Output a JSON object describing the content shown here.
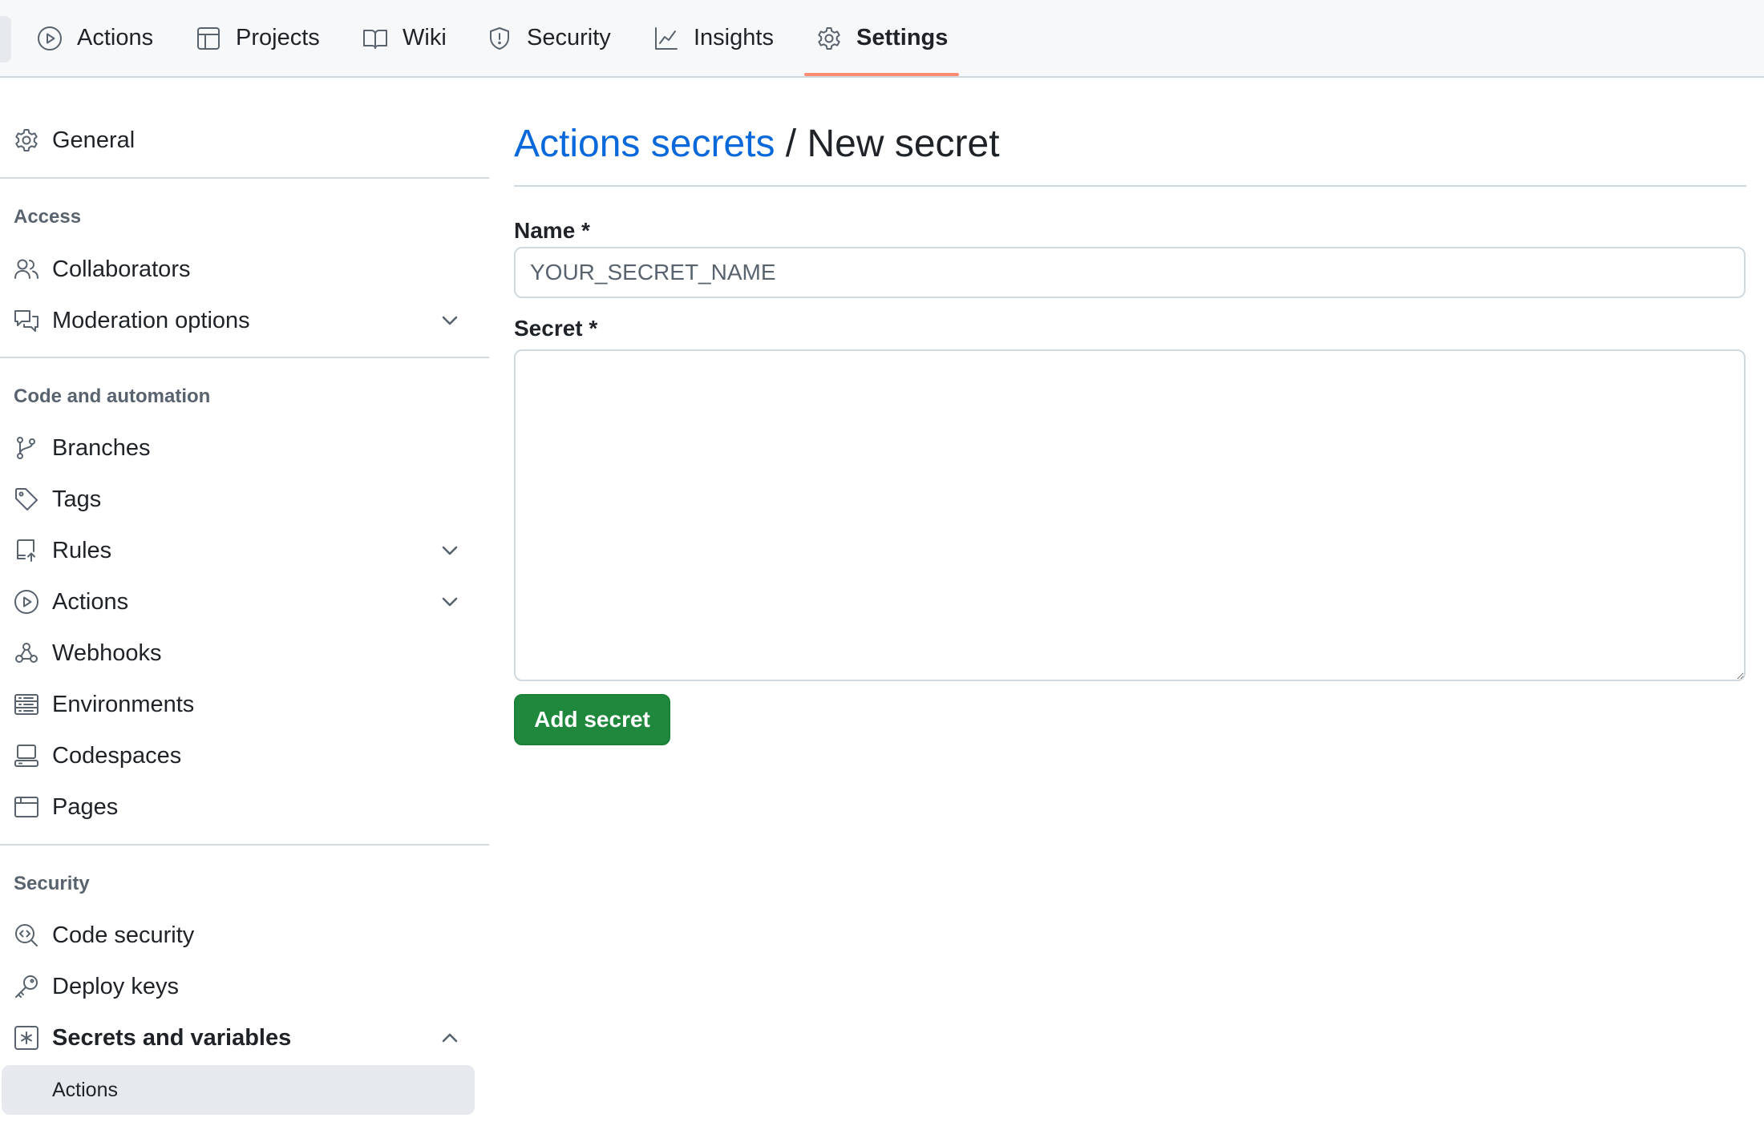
{
  "topnav": {
    "tabs": [
      {
        "label": "Actions",
        "icon": "play-icon"
      },
      {
        "label": "Projects",
        "icon": "table-icon"
      },
      {
        "label": "Wiki",
        "icon": "book-icon"
      },
      {
        "label": "Security",
        "icon": "shield-icon"
      },
      {
        "label": "Insights",
        "icon": "graph-icon"
      },
      {
        "label": "Settings",
        "icon": "gear-icon",
        "selected": true
      }
    ],
    "selected_underline_color": "#fd8c73"
  },
  "sidebar": {
    "general": {
      "label": "General",
      "icon": "gear-icon"
    },
    "access": {
      "heading": "Access",
      "items": [
        {
          "label": "Collaborators",
          "icon": "people-icon"
        },
        {
          "label": "Moderation options",
          "icon": "comment-discussion-icon",
          "expandable": true
        }
      ]
    },
    "code_automation": {
      "heading": "Code and automation",
      "items": [
        {
          "label": "Branches",
          "icon": "git-branch-icon"
        },
        {
          "label": "Tags",
          "icon": "tag-icon"
        },
        {
          "label": "Rules",
          "icon": "repo-push-icon",
          "expandable": true
        },
        {
          "label": "Actions",
          "icon": "play-icon",
          "expandable": true
        },
        {
          "label": "Webhooks",
          "icon": "webhook-icon"
        },
        {
          "label": "Environments",
          "icon": "server-icon"
        },
        {
          "label": "Codespaces",
          "icon": "codespaces-icon"
        },
        {
          "label": "Pages",
          "icon": "browser-icon"
        }
      ]
    },
    "security": {
      "heading": "Security",
      "items": [
        {
          "label": "Code security",
          "icon": "codescan-icon"
        },
        {
          "label": "Deploy keys",
          "icon": "key-icon"
        },
        {
          "label": "Secrets and variables",
          "icon": "key-asterisk-icon",
          "expanded": true
        }
      ],
      "subitems": [
        {
          "label": "Actions",
          "selected": true
        }
      ]
    }
  },
  "main": {
    "breadcrumb_link": "Actions secrets",
    "title_rest": " / New secret",
    "name_label": "Name *",
    "name_placeholder": "YOUR_SECRET_NAME",
    "name_value": "",
    "secret_label": "Secret *",
    "secret_value": "",
    "submit_label": "Add secret"
  },
  "colors": {
    "link": "#0969da",
    "primary_button": "#1f883d",
    "nav_background": "#f6f8fa",
    "selected_background": "#e6e9ed"
  }
}
